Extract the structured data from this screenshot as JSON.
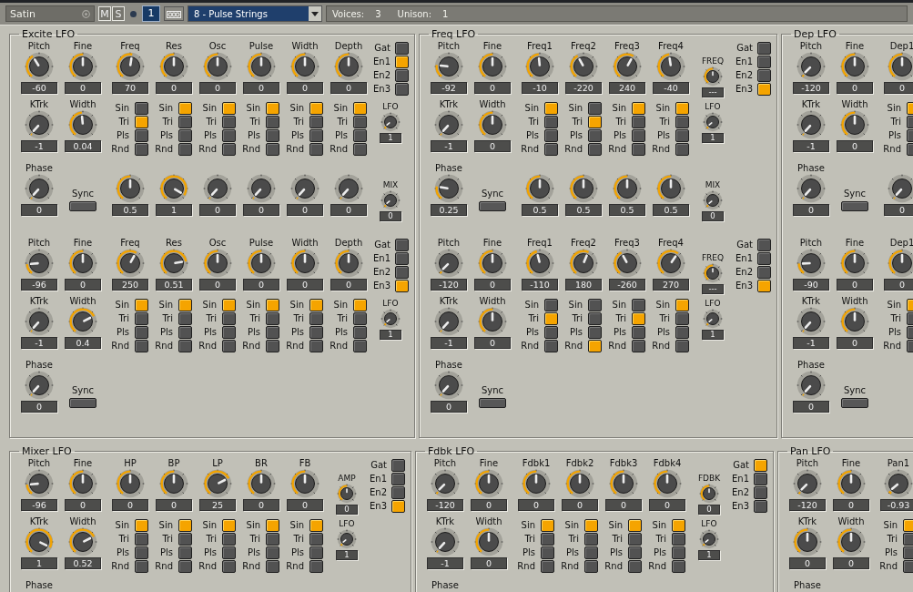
{
  "header": {
    "name": "Satin",
    "mute": "M",
    "solo": "S",
    "channel": "1",
    "preset": "8 - Pulse Strings",
    "voices_label": "Voices:",
    "voices": "3",
    "unison_label": "Unison:",
    "unison": "1"
  },
  "rows": [
    {
      "panels": [
        {
          "title": "Excite LFO",
          "sections": [
            {
              "knobs": [
                {
                  "label": "Pitch",
                  "value": "-60",
                  "level": 0.39
                },
                {
                  "label": "Fine",
                  "value": "0",
                  "level": 0.5
                },
                {
                  "label": "Freq",
                  "value": "70",
                  "level": 0.53
                },
                {
                  "label": "Res",
                  "value": "0",
                  "level": 0.5
                },
                {
                  "label": "Osc",
                  "value": "0",
                  "level": 0.5
                },
                {
                  "label": "Pulse",
                  "value": "0",
                  "level": 0.5
                },
                {
                  "label": "Width",
                  "value": "0",
                  "level": 0.5
                },
                {
                  "label": "Depth",
                  "value": "0",
                  "level": 0.5
                }
              ],
              "switches": [
                {
                  "label": "Gat",
                  "on": false
                },
                {
                  "label": "En1",
                  "on": true
                },
                {
                  "label": "En2",
                  "on": false
                },
                {
                  "label": "En3",
                  "on": false
                }
              ],
              "mods": [
                {
                  "label": "KTrk",
                  "value": "-1",
                  "level": 0.02
                },
                {
                  "label": "Width",
                  "value": "0.04",
                  "level": 0.48
                }
              ],
              "waves": [
                {
                  "items": [
                    {
                      "label": "Sin",
                      "on": false
                    },
                    {
                      "label": "Tri",
                      "on": true
                    },
                    {
                      "label": "Pls",
                      "on": false
                    },
                    {
                      "label": "Rnd",
                      "on": false
                    }
                  ]
                },
                {
                  "items": [
                    {
                      "label": "Sin",
                      "on": true
                    },
                    {
                      "label": "Tri",
                      "on": false
                    },
                    {
                      "label": "Pls",
                      "on": false
                    },
                    {
                      "label": "Rnd",
                      "on": false
                    }
                  ]
                },
                {
                  "items": [
                    {
                      "label": "Sin",
                      "on": true
                    },
                    {
                      "label": "Tri",
                      "on": false
                    },
                    {
                      "label": "Pls",
                      "on": false
                    },
                    {
                      "label": "Rnd",
                      "on": false
                    }
                  ]
                },
                {
                  "items": [
                    {
                      "label": "Sin",
                      "on": true
                    },
                    {
                      "label": "Tri",
                      "on": false
                    },
                    {
                      "label": "Pls",
                      "on": false
                    },
                    {
                      "label": "Rnd",
                      "on": false
                    }
                  ]
                },
                {
                  "items": [
                    {
                      "label": "Sin",
                      "on": true
                    },
                    {
                      "label": "Tri",
                      "on": false
                    },
                    {
                      "label": "Pls",
                      "on": false
                    },
                    {
                      "label": "Rnd",
                      "on": false
                    }
                  ]
                },
                {
                  "items": [
                    {
                      "label": "Sin",
                      "on": true
                    },
                    {
                      "label": "Tri",
                      "on": false
                    },
                    {
                      "label": "Pls",
                      "on": false
                    },
                    {
                      "label": "Rnd",
                      "on": false
                    }
                  ]
                }
              ],
              "lfo": {
                "label": "LFO",
                "value": "1",
                "level": 0.05
              },
              "phase": {
                "label": "Phase",
                "value": "0",
                "level": 0.02
              },
              "sync": "Sync",
              "depths": [
                {
                  "value": "0.5",
                  "level": 0.5
                },
                {
                  "value": "1",
                  "level": 0.92
                },
                {
                  "value": "0",
                  "level": 0.02
                },
                {
                  "value": "0",
                  "level": 0.02
                },
                {
                  "value": "0",
                  "level": 0.02
                },
                {
                  "value": "0",
                  "level": 0.02
                }
              ],
              "mix": {
                "label": "MIX",
                "value": "0",
                "level": 0.05
              }
            },
            {
              "knobs": [
                {
                  "label": "Pitch",
                  "value": "-96",
                  "level": 0.17
                },
                {
                  "label": "Fine",
                  "value": "0",
                  "level": 0.5
                },
                {
                  "label": "Freq",
                  "value": "250",
                  "level": 0.6
                },
                {
                  "label": "Res",
                  "value": "0.51",
                  "level": 0.78
                },
                {
                  "label": "Osc",
                  "value": "0",
                  "level": 0.5
                },
                {
                  "label": "Pulse",
                  "value": "0",
                  "level": 0.5
                },
                {
                  "label": "Width",
                  "value": "0",
                  "level": 0.5
                },
                {
                  "label": "Depth",
                  "value": "0",
                  "level": 0.5
                }
              ],
              "switches": [
                {
                  "label": "Gat",
                  "on": false
                },
                {
                  "label": "En1",
                  "on": false
                },
                {
                  "label": "En2",
                  "on": false
                },
                {
                  "label": "En3",
                  "on": true
                }
              ],
              "mods": [
                {
                  "label": "KTrk",
                  "value": "-1",
                  "level": 0.02
                },
                {
                  "label": "Width",
                  "value": "0.4",
                  "level": 0.72
                }
              ],
              "waves": [
                {
                  "items": [
                    {
                      "label": "Sin",
                      "on": true
                    },
                    {
                      "label": "Tri",
                      "on": false
                    },
                    {
                      "label": "Pls",
                      "on": false
                    },
                    {
                      "label": "Rnd",
                      "on": false
                    }
                  ]
                },
                {
                  "items": [
                    {
                      "label": "Sin",
                      "on": true
                    },
                    {
                      "label": "Tri",
                      "on": false
                    },
                    {
                      "label": "Pls",
                      "on": false
                    },
                    {
                      "label": "Rnd",
                      "on": false
                    }
                  ]
                },
                {
                  "items": [
                    {
                      "label": "Sin",
                      "on": true
                    },
                    {
                      "label": "Tri",
                      "on": false
                    },
                    {
                      "label": "Pls",
                      "on": false
                    },
                    {
                      "label": "Rnd",
                      "on": false
                    }
                  ]
                },
                {
                  "items": [
                    {
                      "label": "Sin",
                      "on": true
                    },
                    {
                      "label": "Tri",
                      "on": false
                    },
                    {
                      "label": "Pls",
                      "on": false
                    },
                    {
                      "label": "Rnd",
                      "on": false
                    }
                  ]
                },
                {
                  "items": [
                    {
                      "label": "Sin",
                      "on": true
                    },
                    {
                      "label": "Tri",
                      "on": false
                    },
                    {
                      "label": "Pls",
                      "on": false
                    },
                    {
                      "label": "Rnd",
                      "on": false
                    }
                  ]
                },
                {
                  "items": [
                    {
                      "label": "Sin",
                      "on": true
                    },
                    {
                      "label": "Tri",
                      "on": false
                    },
                    {
                      "label": "Pls",
                      "on": false
                    },
                    {
                      "label": "Rnd",
                      "on": false
                    }
                  ]
                }
              ],
              "lfo": {
                "label": "LFO",
                "value": "1",
                "level": 0.05
              },
              "phase": {
                "label": "Phase",
                "value": "0",
                "level": 0.02
              },
              "sync": "Sync"
            }
          ]
        },
        {
          "title": "Freq LFO",
          "sections": [
            {
              "knobs": [
                {
                  "label": "Pitch",
                  "value": "-92",
                  "level": 0.21
                },
                {
                  "label": "Fine",
                  "value": "0",
                  "level": 0.5
                },
                {
                  "label": "Freq1",
                  "value": "-10",
                  "level": 0.48
                },
                {
                  "label": "Freq2",
                  "value": "-220",
                  "level": 0.4
                },
                {
                  "label": "Freq3",
                  "value": "240",
                  "level": 0.6
                },
                {
                  "label": "Freq4",
                  "value": "-40",
                  "level": 0.47
                }
              ],
              "aux": {
                "label": "FREQ",
                "value": "---",
                "level": 0.5
              },
              "switches": [
                {
                  "label": "Gat",
                  "on": false
                },
                {
                  "label": "En1",
                  "on": false
                },
                {
                  "label": "En2",
                  "on": false
                },
                {
                  "label": "En3",
                  "on": true
                }
              ],
              "mods": [
                {
                  "label": "KTrk",
                  "value": "-1",
                  "level": 0.02
                },
                {
                  "label": "Width",
                  "value": "0",
                  "level": 0.5
                }
              ],
              "waves": [
                {
                  "items": [
                    {
                      "label": "Sin",
                      "on": true
                    },
                    {
                      "label": "Tri",
                      "on": false
                    },
                    {
                      "label": "Pls",
                      "on": false
                    },
                    {
                      "label": "Rnd",
                      "on": false
                    }
                  ]
                },
                {
                  "items": [
                    {
                      "label": "Sin",
                      "on": false
                    },
                    {
                      "label": "Tri",
                      "on": true
                    },
                    {
                      "label": "Pls",
                      "on": false
                    },
                    {
                      "label": "Rnd",
                      "on": false
                    }
                  ]
                },
                {
                  "items": [
                    {
                      "label": "Sin",
                      "on": true
                    },
                    {
                      "label": "Tri",
                      "on": false
                    },
                    {
                      "label": "Pls",
                      "on": false
                    },
                    {
                      "label": "Rnd",
                      "on": false
                    }
                  ]
                },
                {
                  "items": [
                    {
                      "label": "Sin",
                      "on": true
                    },
                    {
                      "label": "Tri",
                      "on": false
                    },
                    {
                      "label": "Pls",
                      "on": false
                    },
                    {
                      "label": "Rnd",
                      "on": false
                    }
                  ]
                }
              ],
              "lfo": {
                "label": "LFO",
                "value": "1",
                "level": 0.05
              },
              "phase": {
                "label": "Phase",
                "value": "0.25",
                "level": 0.22
              },
              "sync": "Sync",
              "depths": [
                {
                  "value": "0.5",
                  "level": 0.5
                },
                {
                  "value": "0.5",
                  "level": 0.5
                },
                {
                  "value": "0.5",
                  "level": 0.5
                },
                {
                  "value": "0.5",
                  "level": 0.5
                }
              ],
              "mix": {
                "label": "MIX",
                "value": "0",
                "level": 0.05
              }
            },
            {
              "knobs": [
                {
                  "label": "Pitch",
                  "value": "-120",
                  "level": 0.03
                },
                {
                  "label": "Fine",
                  "value": "0",
                  "level": 0.5
                },
                {
                  "label": "Freq1",
                  "value": "-110",
                  "level": 0.45
                },
                {
                  "label": "Freq2",
                  "value": "180",
                  "level": 0.58
                },
                {
                  "label": "Freq3",
                  "value": "-260",
                  "level": 0.4
                },
                {
                  "label": "Freq4",
                  "value": "270",
                  "level": 0.62
                }
              ],
              "aux": {
                "label": "FREQ",
                "value": "---",
                "level": 0.5
              },
              "switches": [
                {
                  "label": "Gat",
                  "on": false
                },
                {
                  "label": "En1",
                  "on": false
                },
                {
                  "label": "En2",
                  "on": false
                },
                {
                  "label": "En3",
                  "on": true
                }
              ],
              "mods": [
                {
                  "label": "KTrk",
                  "value": "-1",
                  "level": 0.02
                },
                {
                  "label": "Width",
                  "value": "0",
                  "level": 0.5
                }
              ],
              "waves": [
                {
                  "items": [
                    {
                      "label": "Sin",
                      "on": false
                    },
                    {
                      "label": "Tri",
                      "on": true
                    },
                    {
                      "label": "Pls",
                      "on": false
                    },
                    {
                      "label": "Rnd",
                      "on": false
                    }
                  ]
                },
                {
                  "items": [
                    {
                      "label": "Sin",
                      "on": false
                    },
                    {
                      "label": "Tri",
                      "on": false
                    },
                    {
                      "label": "Pls",
                      "on": false
                    },
                    {
                      "label": "Rnd",
                      "on": true
                    }
                  ]
                },
                {
                  "items": [
                    {
                      "label": "Sin",
                      "on": false
                    },
                    {
                      "label": "Tri",
                      "on": true
                    },
                    {
                      "label": "Pls",
                      "on": false
                    },
                    {
                      "label": "Rnd",
                      "on": false
                    }
                  ]
                },
                {
                  "items": [
                    {
                      "label": "Sin",
                      "on": true
                    },
                    {
                      "label": "Tri",
                      "on": false
                    },
                    {
                      "label": "Pls",
                      "on": false
                    },
                    {
                      "label": "Rnd",
                      "on": false
                    }
                  ]
                }
              ],
              "lfo": {
                "label": "LFO",
                "value": "1",
                "level": 0.05
              },
              "phase": {
                "label": "Phase",
                "value": "0",
                "level": 0.02
              },
              "sync": "Sync"
            }
          ]
        },
        {
          "title": "Dep LFO",
          "sections": [
            {
              "knobs": [
                {
                  "label": "Pitch",
                  "value": "-120",
                  "level": 0.03
                },
                {
                  "label": "Fine",
                  "value": "0",
                  "level": 0.5
                },
                {
                  "label": "Dep1",
                  "value": "0",
                  "level": 0.5
                }
              ],
              "mods": [
                {
                  "label": "KTrk",
                  "value": "-1",
                  "level": 0.02
                },
                {
                  "label": "Width",
                  "value": "0",
                  "level": 0.5
                }
              ],
              "waves": [
                {
                  "items": [
                    {
                      "label": "Sin",
                      "on": true
                    },
                    {
                      "label": "Tri",
                      "on": false
                    },
                    {
                      "label": "Pls",
                      "on": false
                    },
                    {
                      "label": "Rnd",
                      "on": false
                    }
                  ]
                }
              ],
              "phase": {
                "label": "Phase",
                "value": "0",
                "level": 0.02
              },
              "sync": "Sync",
              "depths": [
                {
                  "value": "0",
                  "level": 0.02
                }
              ]
            },
            {
              "knobs": [
                {
                  "label": "Pitch",
                  "value": "-90",
                  "level": 0.18
                },
                {
                  "label": "Fine",
                  "value": "0",
                  "level": 0.5
                },
                {
                  "label": "Dep1",
                  "value": "0",
                  "level": 0.5
                }
              ],
              "mods": [
                {
                  "label": "KTrk",
                  "value": "-1",
                  "level": 0.02
                },
                {
                  "label": "Width",
                  "value": "0",
                  "level": 0.5
                }
              ],
              "waves": [
                {
                  "items": [
                    {
                      "label": "Sin",
                      "on": true
                    },
                    {
                      "label": "Tri",
                      "on": false
                    },
                    {
                      "label": "Pls",
                      "on": false
                    },
                    {
                      "label": "Rnd",
                      "on": false
                    }
                  ]
                }
              ],
              "phase": {
                "label": "Phase",
                "value": "0",
                "level": 0.02
              },
              "sync": "Sync"
            }
          ]
        }
      ]
    },
    {
      "panels": [
        {
          "title": "Mixer LFO",
          "sections": [
            {
              "knobs": [
                {
                  "label": "Pitch",
                  "value": "-96",
                  "level": 0.17
                },
                {
                  "label": "Fine",
                  "value": "0",
                  "level": 0.5
                },
                {
                  "label": "HP",
                  "value": "0",
                  "level": 0.5
                },
                {
                  "label": "BP",
                  "value": "0",
                  "level": 0.5
                },
                {
                  "label": "LP",
                  "value": "25",
                  "level": 0.72
                },
                {
                  "label": "BR",
                  "value": "0",
                  "level": 0.5
                },
                {
                  "label": "FB",
                  "value": "0",
                  "level": 0.5
                }
              ],
              "aux": {
                "label": "AMP",
                "value": "0",
                "level": 0.5
              },
              "switches": [
                {
                  "label": "Gat",
                  "on": false
                },
                {
                  "label": "En1",
                  "on": false
                },
                {
                  "label": "En2",
                  "on": false
                },
                {
                  "label": "En3",
                  "on": true
                }
              ],
              "mods": [
                {
                  "label": "KTrk",
                  "value": "1",
                  "level": 0.9
                },
                {
                  "label": "Width",
                  "value": "0.52",
                  "level": 0.72
                }
              ],
              "waves": [
                {
                  "items": [
                    {
                      "label": "Sin",
                      "on": true
                    },
                    {
                      "label": "Tri",
                      "on": false
                    },
                    {
                      "label": "Pls",
                      "on": false
                    },
                    {
                      "label": "Rnd",
                      "on": false
                    }
                  ]
                },
                {
                  "items": [
                    {
                      "label": "Sin",
                      "on": true
                    },
                    {
                      "label": "Tri",
                      "on": false
                    },
                    {
                      "label": "Pls",
                      "on": false
                    },
                    {
                      "label": "Rnd",
                      "on": false
                    }
                  ]
                },
                {
                  "items": [
                    {
                      "label": "Sin",
                      "on": true
                    },
                    {
                      "label": "Tri",
                      "on": false
                    },
                    {
                      "label": "Pls",
                      "on": false
                    },
                    {
                      "label": "Rnd",
                      "on": false
                    }
                  ]
                },
                {
                  "items": [
                    {
                      "label": "Sin",
                      "on": true
                    },
                    {
                      "label": "Tri",
                      "on": false
                    },
                    {
                      "label": "Pls",
                      "on": false
                    },
                    {
                      "label": "Rnd",
                      "on": false
                    }
                  ]
                },
                {
                  "items": [
                    {
                      "label": "Sin",
                      "on": true
                    },
                    {
                      "label": "Tri",
                      "on": false
                    },
                    {
                      "label": "Pls",
                      "on": false
                    },
                    {
                      "label": "Rnd",
                      "on": false
                    }
                  ]
                }
              ],
              "lfo": {
                "label": "LFO",
                "value": "1",
                "level": 0.05
              },
              "phase": {
                "label": "Phase"
              }
            }
          ]
        },
        {
          "title": "Fdbk LFO",
          "sections": [
            {
              "knobs": [
                {
                  "label": "Pitch",
                  "value": "-120",
                  "level": 0.03
                },
                {
                  "label": "Fine",
                  "value": "0",
                  "level": 0.5
                },
                {
                  "label": "Fdbk1",
                  "value": "0",
                  "level": 0.5
                },
                {
                  "label": "Fdbk2",
                  "value": "0",
                  "level": 0.5
                },
                {
                  "label": "Fdbk3",
                  "value": "0",
                  "level": 0.5
                },
                {
                  "label": "Fdbk4",
                  "value": "0",
                  "level": 0.5
                }
              ],
              "aux": {
                "label": "FDBK",
                "value": "0",
                "level": 0.5
              },
              "switches": [
                {
                  "label": "Gat",
                  "on": true
                },
                {
                  "label": "En1",
                  "on": false
                },
                {
                  "label": "En2",
                  "on": false
                },
                {
                  "label": "En3",
                  "on": false
                }
              ],
              "mods": [
                {
                  "label": "KTrk",
                  "value": "-1",
                  "level": 0.02
                },
                {
                  "label": "Width",
                  "value": "0",
                  "level": 0.5
                }
              ],
              "waves": [
                {
                  "items": [
                    {
                      "label": "Sin",
                      "on": true
                    },
                    {
                      "label": "Tri",
                      "on": false
                    },
                    {
                      "label": "Pls",
                      "on": false
                    },
                    {
                      "label": "Rnd",
                      "on": false
                    }
                  ]
                },
                {
                  "items": [
                    {
                      "label": "Sin",
                      "on": true
                    },
                    {
                      "label": "Tri",
                      "on": false
                    },
                    {
                      "label": "Pls",
                      "on": false
                    },
                    {
                      "label": "Rnd",
                      "on": false
                    }
                  ]
                },
                {
                  "items": [
                    {
                      "label": "Sin",
                      "on": true
                    },
                    {
                      "label": "Tri",
                      "on": false
                    },
                    {
                      "label": "Pls",
                      "on": false
                    },
                    {
                      "label": "Rnd",
                      "on": false
                    }
                  ]
                },
                {
                  "items": [
                    {
                      "label": "Sin",
                      "on": true
                    },
                    {
                      "label": "Tri",
                      "on": false
                    },
                    {
                      "label": "Pls",
                      "on": false
                    },
                    {
                      "label": "Rnd",
                      "on": false
                    }
                  ]
                }
              ],
              "lfo": {
                "label": "LFO",
                "value": "1",
                "level": 0.05
              },
              "phase": {
                "label": "Phase"
              }
            }
          ]
        },
        {
          "title": "Pan LFO",
          "sections": [
            {
              "knobs": [
                {
                  "label": "Pitch",
                  "value": "-120",
                  "level": 0.03
                },
                {
                  "label": "Fine",
                  "value": "0",
                  "level": 0.5
                },
                {
                  "label": "Pan1",
                  "value": "-0.93",
                  "level": 0.05
                }
              ],
              "mods": [
                {
                  "label": "KTrk",
                  "value": "0",
                  "level": 0.5
                },
                {
                  "label": "Width",
                  "value": "0",
                  "level": 0.5
                }
              ],
              "waves": [
                {
                  "items": [
                    {
                      "label": "Sin",
                      "on": true
                    },
                    {
                      "label": "Tri",
                      "on": false
                    },
                    {
                      "label": "Pls",
                      "on": false
                    },
                    {
                      "label": "Rnd",
                      "on": false
                    }
                  ]
                }
              ],
              "phase": {
                "label": "Phase"
              }
            }
          ]
        }
      ]
    }
  ]
}
